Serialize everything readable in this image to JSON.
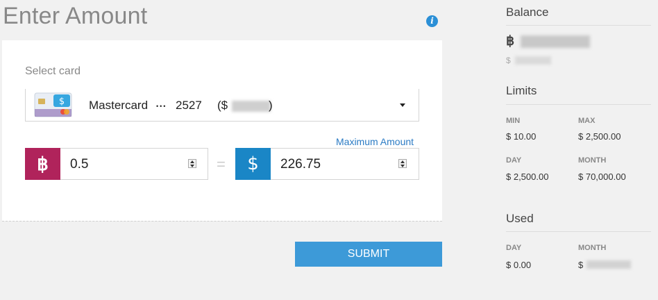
{
  "page": {
    "title": "Enter Amount"
  },
  "form": {
    "select_label": "Select card",
    "selected_card": {
      "name": "Mastercard",
      "mask": "•••",
      "last4": "2527",
      "paren_open": "($",
      "paren_close": ")"
    },
    "max_amount_label": "Maximum Amount",
    "btc": {
      "symbol": "฿",
      "value": "0.5"
    },
    "equals": "=",
    "usd": {
      "symbol": "$",
      "value": "226.75"
    },
    "submit_label": "SUBMIT"
  },
  "balance": {
    "heading": "Balance",
    "btc_symbol": "฿",
    "usd_symbol": "$"
  },
  "limits": {
    "heading": "Limits",
    "min_label": "MIN",
    "min_value": "$ 10.00",
    "max_label": "MAX",
    "max_value": "$ 2,500.00",
    "day_label": "DAY",
    "day_value": "$ 2,500.00",
    "month_label": "MONTH",
    "month_value": "$ 70,000.00"
  },
  "used": {
    "heading": "Used",
    "day_label": "DAY",
    "day_value": "$ 0.00",
    "month_label": "MONTH",
    "month_symbol": "$"
  },
  "colors": {
    "btc_badge": "#b0235b",
    "usd_badge": "#1a86c6",
    "submit": "#3d9ad8",
    "link": "#2b7bc4"
  },
  "icons": {
    "info": "info-icon",
    "btc": "bitcoin-icon",
    "usd": "dollar-icon",
    "caret": "chevron-down-icon"
  }
}
